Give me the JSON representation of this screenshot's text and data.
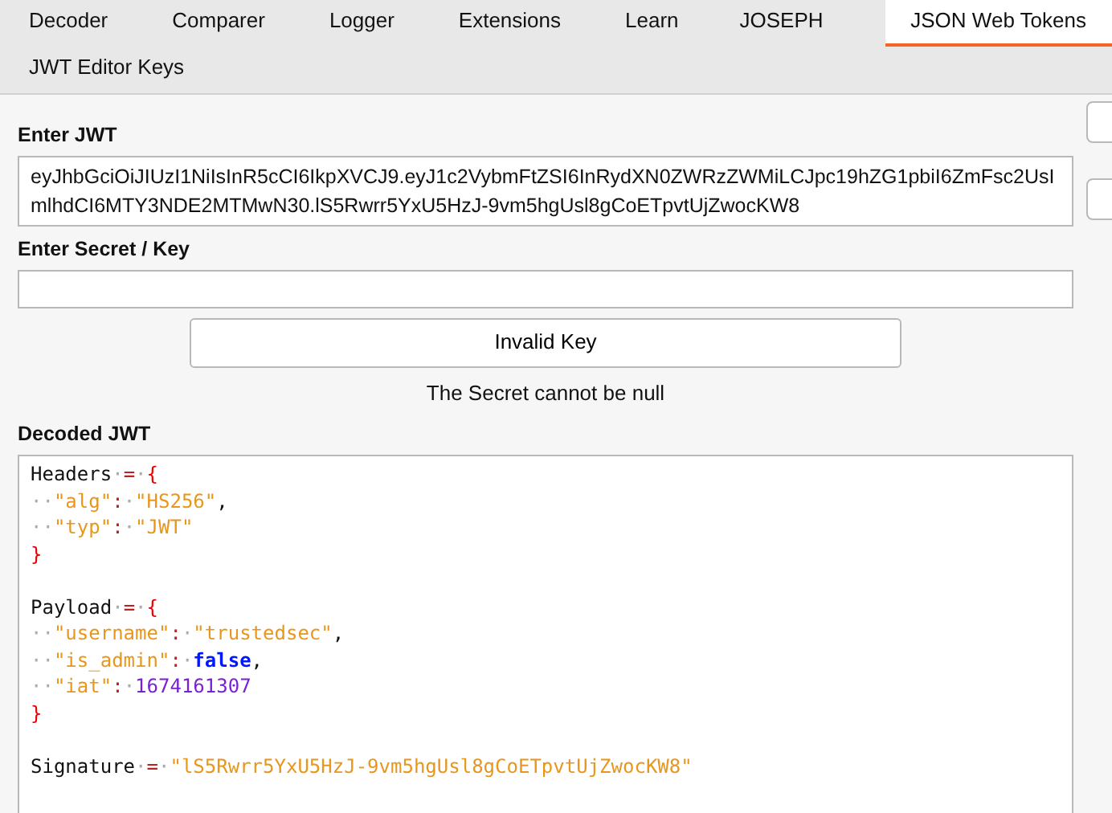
{
  "tabs": [
    {
      "label": "Decoder",
      "selected": false
    },
    {
      "label": "Comparer",
      "selected": false
    },
    {
      "label": "Logger",
      "selected": false
    },
    {
      "label": "Extensions",
      "selected": false
    },
    {
      "label": "Learn",
      "selected": false
    },
    {
      "label": "JOSEPH",
      "selected": false
    },
    {
      "label": "JSON Web Tokens",
      "selected": true
    },
    {
      "label": "JWT Editor Keys",
      "selected": false
    }
  ],
  "jwt": {
    "label": "Enter JWT",
    "value": "eyJhbGciOiJIUzI1NiIsInR5cCI6IkpXVCJ9.eyJ1c2VybmFtZSI6InRydXN0ZWRzZWMiLCJpc19hZG1pbiI6ZmFsc2UsImlhdCI6MTY3NDE2MTMwN30.lS5Rwrr5YxU5HzJ-9vm5hgUsl8gCoETpvtUjZwocKW8"
  },
  "secret": {
    "label": "Enter Secret / Key"
  },
  "key_button": "Invalid Key",
  "message": "The Secret cannot be null",
  "decoded": {
    "label": "Decoded JWT",
    "blocks": [
      {
        "lines": [
          [
            {
              "kind": "plain",
              "text": "Headers"
            },
            {
              "kind": "ws",
              "text": "·"
            },
            {
              "kind": "op",
              "text": "="
            },
            {
              "kind": "ws",
              "text": "·"
            },
            {
              "kind": "brace",
              "text": "{"
            }
          ],
          [
            {
              "kind": "ws",
              "text": "··"
            },
            {
              "kind": "string",
              "text": "\"alg\""
            },
            {
              "kind": "op",
              "text": ":"
            },
            {
              "kind": "ws",
              "text": "·"
            },
            {
              "kind": "string",
              "text": "\"HS256\""
            },
            {
              "kind": "plain",
              "text": ","
            }
          ],
          [
            {
              "kind": "ws",
              "text": "··"
            },
            {
              "kind": "string",
              "text": "\"typ\""
            },
            {
              "kind": "op",
              "text": ":"
            },
            {
              "kind": "ws",
              "text": "·"
            },
            {
              "kind": "string",
              "text": "\"JWT\""
            }
          ],
          [
            {
              "kind": "brace",
              "text": "}"
            }
          ]
        ]
      },
      {
        "lines": [
          [
            {
              "kind": "plain",
              "text": "Payload"
            },
            {
              "kind": "ws",
              "text": "·"
            },
            {
              "kind": "op",
              "text": "="
            },
            {
              "kind": "ws",
              "text": "·"
            },
            {
              "kind": "brace",
              "text": "{"
            }
          ],
          [
            {
              "kind": "ws",
              "text": "··"
            },
            {
              "kind": "string",
              "text": "\"username\""
            },
            {
              "kind": "op",
              "text": ":"
            },
            {
              "kind": "ws",
              "text": "·"
            },
            {
              "kind": "string",
              "text": "\"trustedsec\""
            },
            {
              "kind": "plain",
              "text": ","
            }
          ],
          [
            {
              "kind": "ws",
              "text": "··"
            },
            {
              "kind": "string",
              "text": "\"is_admin\""
            },
            {
              "kind": "op",
              "text": ":"
            },
            {
              "kind": "ws",
              "text": "·"
            },
            {
              "kind": "keyword",
              "text": "false"
            },
            {
              "kind": "plain",
              "text": ","
            }
          ],
          [
            {
              "kind": "ws",
              "text": "··"
            },
            {
              "kind": "string",
              "text": "\"iat\""
            },
            {
              "kind": "op",
              "text": ":"
            },
            {
              "kind": "ws",
              "text": "·"
            },
            {
              "kind": "number",
              "text": "1674161307"
            }
          ],
          [
            {
              "kind": "brace",
              "text": "}"
            }
          ]
        ]
      },
      {
        "lines": [
          [
            {
              "kind": "plain",
              "text": "Signature"
            },
            {
              "kind": "ws",
              "text": "·"
            },
            {
              "kind": "op",
              "text": "="
            },
            {
              "kind": "ws",
              "text": "·"
            },
            {
              "kind": "string",
              "text": "\"lS5Rwrr5YxU5HzJ-9vm5hgUsl8gCoETpvtUjZwocKW8\""
            }
          ]
        ]
      }
    ]
  }
}
